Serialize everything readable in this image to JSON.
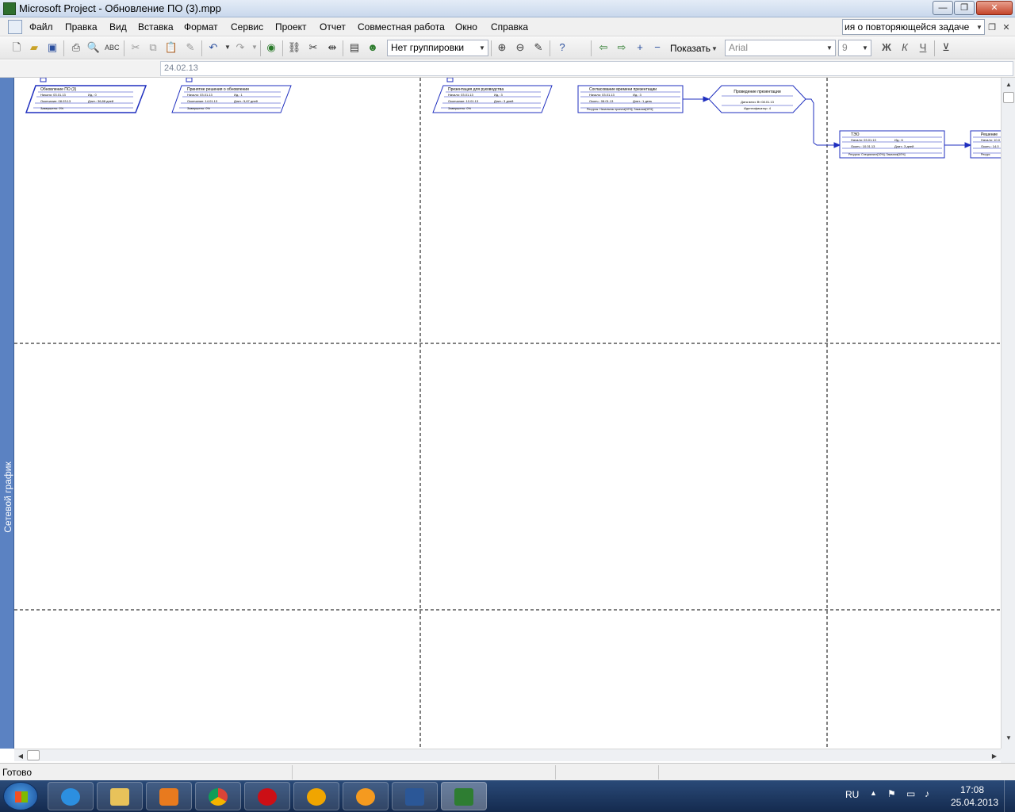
{
  "window": {
    "title": "Microsoft Project - Обновление ПО (3).mpp",
    "controls": {
      "minimize": "—",
      "restore": "❐",
      "close": "✕"
    }
  },
  "menu": {
    "items": [
      "Файл",
      "Правка",
      "Вид",
      "Вставка",
      "Формат",
      "Сервис",
      "Проект",
      "Отчет",
      "Совместная работа",
      "Окно",
      "Справка"
    ],
    "question_box": "ия о повторяющейся задаче"
  },
  "toolbar": {
    "grouping": "Нет группировки",
    "show_label": "Показать",
    "font_name": "Arial",
    "font_size": "9",
    "bold": "Ж",
    "italic": "К",
    "underline": "Ч"
  },
  "entry_bar": {
    "value": "24.02.13"
  },
  "view_bar": {
    "label": "Сетевой график"
  },
  "network": {
    "nodes": [
      {
        "id": "n1",
        "title": "Обновление ПО (3)",
        "row1a": "Начало: 03.01.13",
        "row1b": "Ид.: 0",
        "row2a": "Окончание: 08.03.13",
        "row2b": "Длит.: 36,88 дней",
        "row3": "Завершено: 0%"
      },
      {
        "id": "n2",
        "title": "Принятие решения о обновлении",
        "row1a": "Начало: 03.01.13",
        "row1b": "Ид.: 1",
        "row2a": "Окончание: 14.01.13",
        "row2b": "Длит.: 5,67 дней",
        "row3": "Завершено: 0%"
      },
      {
        "id": "n3",
        "title": "Презентация для руководства",
        "row1a": "Начало: 03.01.13",
        "row1b": "Ид.: 3",
        "row2a": "Окончание: 10.01.13",
        "row2b": "Длит.: 3 дней",
        "row3": "Завершено: 0%"
      },
      {
        "id": "n4",
        "title": "Согласование времени презентации",
        "row1a": "Начало: 03.01.13",
        "row1b": "Ид.: 3",
        "row2a": "Оконч.: 08.01.13",
        "row2b": "Длит.: 1 день",
        "row3": "Ресурсы: Начальник проекта[10%]; Заказчик[10%]"
      },
      {
        "id": "n5",
        "title": "Проведение презентации",
        "row1a": "Дата вехи: Вт 08.01.13",
        "row1b": "",
        "row2a": "Идентификатор: 4",
        "row2b": "",
        "row3": ""
      },
      {
        "id": "n6",
        "title": "ТЭО",
        "row1a": "Начало: 03.01.13",
        "row1b": "Ид.: 6",
        "row2a": "Оконч.: 10.01.13",
        "row2b": "Длит.: 3 дней",
        "row3": "Ресурсы: Специалист[10%]; Заказчик[10%]"
      },
      {
        "id": "n7",
        "title": "Решение",
        "row1a": "Начало: 10.0",
        "row1b": "",
        "row2a": "Оконч.: 14.0",
        "row2b": "",
        "row3": "Ресурс"
      }
    ]
  },
  "status": {
    "text": "Готово"
  },
  "taskbar": {
    "language": "RU",
    "time": "17:08",
    "date": "25.04.2013",
    "apps": [
      "internet-explorer",
      "file-explorer",
      "media-player",
      "chrome",
      "opera",
      "aimp",
      "mail-agent",
      "word",
      "project"
    ]
  },
  "colors": {
    "accent": "#1f2fbf",
    "view_bar": "#5b82c2",
    "taskbar": "#1d3a66"
  }
}
